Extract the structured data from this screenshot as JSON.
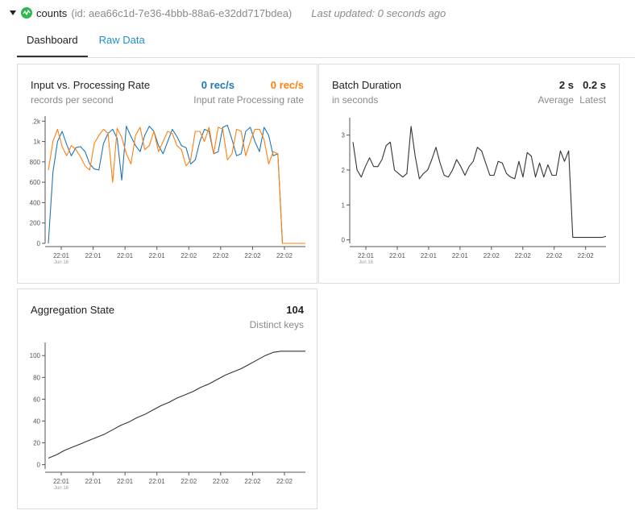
{
  "header": {
    "name": "counts",
    "id_text": "(id: aea66c1d-7e36-4bbb-88a6-e32dd717bdea)",
    "last_updated": "Last updated: 0 seconds ago"
  },
  "tabs": [
    {
      "label": "Dashboard",
      "active": true
    },
    {
      "label": "Raw Data",
      "active": false
    }
  ],
  "colors": {
    "input_rate": "#1f77b4",
    "processing_rate": "#ff7f0e",
    "line": "#333333",
    "status": "#2db84d",
    "link": "#1f8fc9"
  },
  "x_axis": {
    "tick_labels": [
      "22:01",
      "22:01",
      "22:01",
      "22:01",
      "22:02",
      "22:02",
      "22:02",
      "22:02"
    ],
    "sub_label": "Jun 16"
  },
  "input_processing": {
    "title": "Input vs. Processing Rate",
    "subtitle": "records per second",
    "stat_input_value": "0 rec/s",
    "stat_input_label": "Input rate",
    "stat_processing_value": "0 rec/s",
    "stat_processing_label": "Processing rate"
  },
  "batch_duration": {
    "title": "Batch Duration",
    "subtitle": "in seconds",
    "stat_average_value": "2 s",
    "stat_average_label": "Average",
    "stat_latest_value": "0.2 s",
    "stat_latest_label": "Latest"
  },
  "aggregation": {
    "title": "Aggregation State",
    "value": "104",
    "value_label": "Distinct keys"
  },
  "chart_data": [
    {
      "type": "line",
      "title": "Input vs. Processing Rate",
      "ylabel": "records per second",
      "y_tick_labels": [
        ".2k",
        "1k",
        "800",
        "600",
        "400",
        "200",
        "0"
      ],
      "y_ticks": [
        1200,
        1000,
        800,
        600,
        400,
        200,
        0
      ],
      "ylim": [
        0,
        1250
      ],
      "grid": false,
      "series": [
        {
          "name": "Input rate",
          "values": [
            0,
            700,
            1000,
            1100,
            970,
            860,
            940,
            950,
            900,
            780,
            730,
            720,
            980,
            1080,
            1120,
            1030,
            620,
            1150,
            1050,
            960,
            900,
            1060,
            1150,
            1100,
            960,
            880,
            1000,
            1120,
            1050,
            960,
            940,
            780,
            820,
            1000,
            1120,
            1100,
            880,
            900,
            1140,
            1160,
            1020,
            860,
            880,
            1100,
            1140,
            1000,
            900,
            1140,
            1060,
            860,
            880,
            0,
            0,
            0,
            0,
            0,
            0
          ]
        },
        {
          "name": "Processing rate",
          "values": [
            720,
            1000,
            1120,
            950,
            860,
            960,
            920,
            850,
            760,
            720,
            980,
            1060,
            1120,
            1080,
            600,
            1130,
            1040,
            880,
            780,
            1060,
            1140,
            920,
            960,
            1100,
            900,
            1000,
            1100,
            1080,
            960,
            920,
            760,
            820,
            1100,
            1100,
            1000,
            1140,
            880,
            1140,
            1120,
            820,
            880,
            1120,
            1100,
            860,
            1000,
            1120,
            1120,
            1020,
            780,
            900,
            880,
            0,
            0,
            0,
            0,
            0,
            0
          ]
        }
      ]
    },
    {
      "type": "line",
      "title": "Batch Duration",
      "ylabel": "in seconds",
      "y_ticks": [
        3,
        2,
        1,
        0
      ],
      "ylim": [
        -0.1,
        3.5
      ],
      "grid": false,
      "series": [
        {
          "values": [
            2.8,
            2.0,
            1.8,
            2.1,
            2.35,
            2.1,
            2.1,
            2.3,
            2.7,
            2.8,
            2.0,
            1.9,
            1.8,
            1.9,
            3.25,
            2.4,
            1.75,
            1.9,
            2.0,
            2.3,
            2.65,
            2.2,
            1.85,
            1.8,
            2.0,
            2.3,
            2.1,
            1.85,
            2.1,
            2.25,
            2.65,
            2.55,
            2.2,
            1.85,
            1.85,
            2.25,
            2.2,
            1.9,
            1.8,
            1.75,
            2.25,
            1.8,
            2.5,
            2.4,
            1.8,
            2.2,
            1.8,
            2.15,
            1.85,
            1.85,
            2.55,
            2.25,
            2.55,
            0.07,
            0.07,
            0.07,
            0.07,
            0.07,
            0.07,
            0.07,
            0.07,
            0.1
          ]
        }
      ]
    },
    {
      "type": "line",
      "title": "Aggregation State",
      "ylabel": "Distinct keys",
      "y_ticks": [
        100,
        80,
        60,
        40,
        20,
        0
      ],
      "ylim": [
        -4,
        112
      ],
      "grid": false,
      "series": [
        {
          "values": [
            6,
            9,
            13,
            16,
            19,
            22,
            25,
            28,
            32,
            36,
            39,
            43,
            46,
            50,
            54,
            57,
            61,
            64,
            67,
            71,
            74,
            78,
            82,
            85,
            88,
            92,
            96,
            100,
            103,
            104,
            104,
            104,
            104
          ]
        }
      ]
    }
  ]
}
